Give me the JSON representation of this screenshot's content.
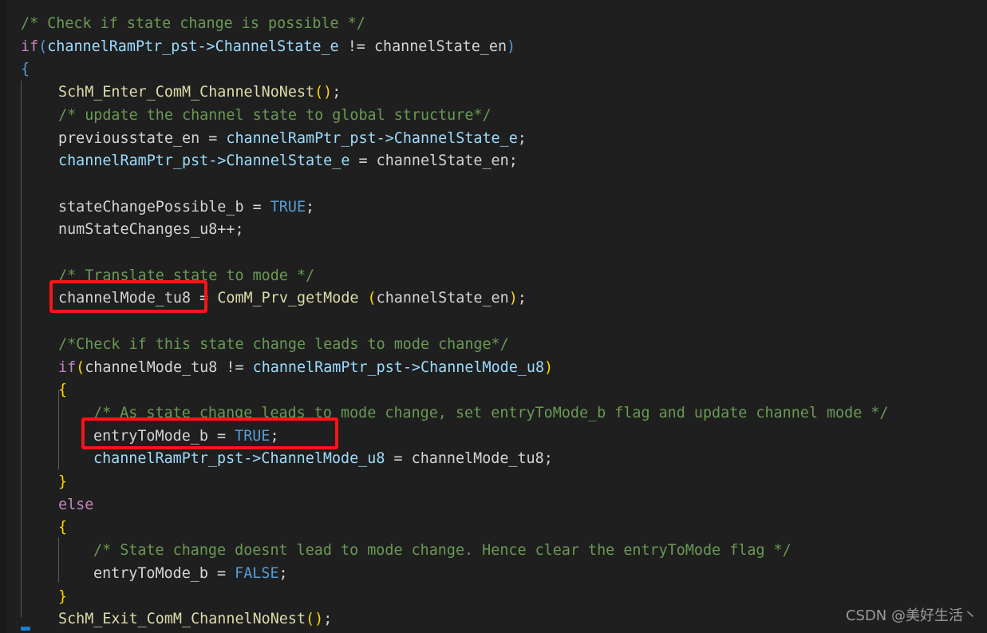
{
  "editor": {
    "background_color": "#1f1f1f",
    "gutter_color": "#1b1b1b",
    "default_text_color": "#d4d4d4",
    "font_size_px": 18.4,
    "line_height_px": 28.7
  },
  "colors": {
    "comment": "#6a9955",
    "keyword": "#c586c0",
    "variable": "#9cdcfe",
    "function": "#dcdcaa",
    "constant": "#569cd6",
    "operator": "#d4d4d4",
    "brace": "#ffd700",
    "paren_blue": "#569cd6",
    "paren_magenta": "#da70d6",
    "plain": "#d4d4d4",
    "annotation_red": "#f71515",
    "indent_guide": "#5a5a5a",
    "watermark": "#9a9a9a",
    "scroll_marker": "#1c7fd6"
  },
  "code": {
    "language": "C",
    "lines": [
      {
        "n": 1,
        "text": "/* Check if state change is possible */"
      },
      {
        "n": 2,
        "text": "if(channelRamPtr_pst->ChannelState_e != channelState_en)"
      },
      {
        "n": 3,
        "text": "{"
      },
      {
        "n": 4,
        "text": "    SchM_Enter_ComM_ChannelNoNest();"
      },
      {
        "n": 5,
        "text": "    /* update the channel state to global structure*/"
      },
      {
        "n": 6,
        "text": "    previousstate_en = channelRamPtr_pst->ChannelState_e;"
      },
      {
        "n": 7,
        "text": "    channelRamPtr_pst->ChannelState_e = channelState_en;"
      },
      {
        "n": 8,
        "text": ""
      },
      {
        "n": 9,
        "text": "    stateChangePossible_b = TRUE;"
      },
      {
        "n": 10,
        "text": "    numStateChanges_u8++;"
      },
      {
        "n": 11,
        "text": ""
      },
      {
        "n": 12,
        "text": "    /* Translate state to mode */"
      },
      {
        "n": 13,
        "text": "    channelMode_tu8 = ComM_Prv_getMode (channelState_en);"
      },
      {
        "n": 14,
        "text": ""
      },
      {
        "n": 15,
        "text": "    /*Check if this state change leads to mode change*/"
      },
      {
        "n": 16,
        "text": "    if(channelMode_tu8 != channelRamPtr_pst->ChannelMode_u8)"
      },
      {
        "n": 17,
        "text": "    {"
      },
      {
        "n": 18,
        "text": "        /* As state change leads to mode change, set entryToMode_b flag and update channel mode */"
      },
      {
        "n": 19,
        "text": "        entryToMode_b = TRUE;"
      },
      {
        "n": 20,
        "text": "        channelRamPtr_pst->ChannelMode_u8 = channelMode_tu8;"
      },
      {
        "n": 21,
        "text": "    }"
      },
      {
        "n": 22,
        "text": "    else"
      },
      {
        "n": 23,
        "text": "    {"
      },
      {
        "n": 24,
        "text": "        /* State change doesnt lead to mode change. Hence clear the entryToMode flag */"
      },
      {
        "n": 25,
        "text": "        entryToMode_b = FALSE;"
      },
      {
        "n": 26,
        "text": "    }"
      },
      {
        "n": 27,
        "text": "    SchM_Exit_ComM_ChannelNoNest();"
      }
    ],
    "tokens": {
      "l1_comment": "/* Check if state change is possible */",
      "l2_if": "if",
      "l2_open_paren": "(",
      "l2_ptr": "channelRamPtr_pst",
      "l2_arrow": "->",
      "l2_member": "ChannelState_e",
      "l2_neq": " != ",
      "l2_rhs": "channelState_en",
      "l2_close_paren": ")",
      "l3_brace": "{",
      "l4_call": "SchM_Enter_ComM_ChannelNoNest",
      "l4_parens": "()",
      "l4_semi": ";",
      "l5_comment": "/* update the channel state to global structure*/",
      "l6_lhs": "previousstate_en",
      "l6_eq": " = ",
      "l6_ptr": "channelRamPtr_pst",
      "l6_arrow": "->",
      "l6_member": "ChannelState_e",
      "l6_semi": ";",
      "l7_ptr": "channelRamPtr_pst",
      "l7_arrow": "->",
      "l7_member": "ChannelState_e",
      "l7_eq": " = ",
      "l7_rhs": "channelState_en",
      "l7_semi": ";",
      "l9_lhs": "stateChangePossible_b",
      "l9_eq": " = ",
      "l9_true": "TRUE",
      "l9_semi": ";",
      "l10_text": "numStateChanges_u8++;",
      "l12_comment": "/* Translate state to mode */",
      "l13_lhs": "channelMode_tu8",
      "l13_eq": " = ",
      "l13_fn": "ComM_Prv_getMode",
      "l13_space": " ",
      "l13_open": "(",
      "l13_arg": "channelState_en",
      "l13_close": ")",
      "l13_semi": ";",
      "l15_comment": "/*Check if this state change leads to mode change*/",
      "l16_if": "if",
      "l16_open": "(",
      "l16_lhs": "channelMode_tu8",
      "l16_neq": " != ",
      "l16_ptr": "channelRamPtr_pst",
      "l16_arrow": "->",
      "l16_member": "ChannelMode_u8",
      "l16_close": ")",
      "l17_brace": "{",
      "l18_comment": "/* As state change leads to mode change, set entryToMode_b flag and update channel mode */",
      "l19_lhs": "entryToMode_b",
      "l19_eq": " = ",
      "l19_true": "TRUE",
      "l19_semi": ";",
      "l20_ptr": "channelRamPtr_pst",
      "l20_arrow": "->",
      "l20_member": "ChannelMode_u8",
      "l20_eq": " = ",
      "l20_rhs": "channelMode_tu8",
      "l20_semi": ";",
      "l21_brace": "}",
      "l22_else": "else",
      "l23_brace": "{",
      "l24_comment": "/* State change doesnt lead to mode change. Hence clear the entryToMode flag */",
      "l25_lhs": "entryToMode_b",
      "l25_eq": " = ",
      "l25_false": "FALSE",
      "l25_semi": ";",
      "l26_brace": "}",
      "l27_call": "SchM_Exit_ComM_ChannelNoNest",
      "l27_parens": "()",
      "l27_semi": ";"
    }
  },
  "annotations": [
    {
      "id": "highlight-channelmode-tu8",
      "target_line": 13,
      "target_text": "channelMode_tu8",
      "color": "#f71515"
    },
    {
      "id": "highlight-entrytomode-true",
      "target_line": 19,
      "target_text": "entryToMode_b = TRUE;",
      "color": "#f71515"
    }
  ],
  "watermark": {
    "text": "CSDN @美好生活丶"
  }
}
